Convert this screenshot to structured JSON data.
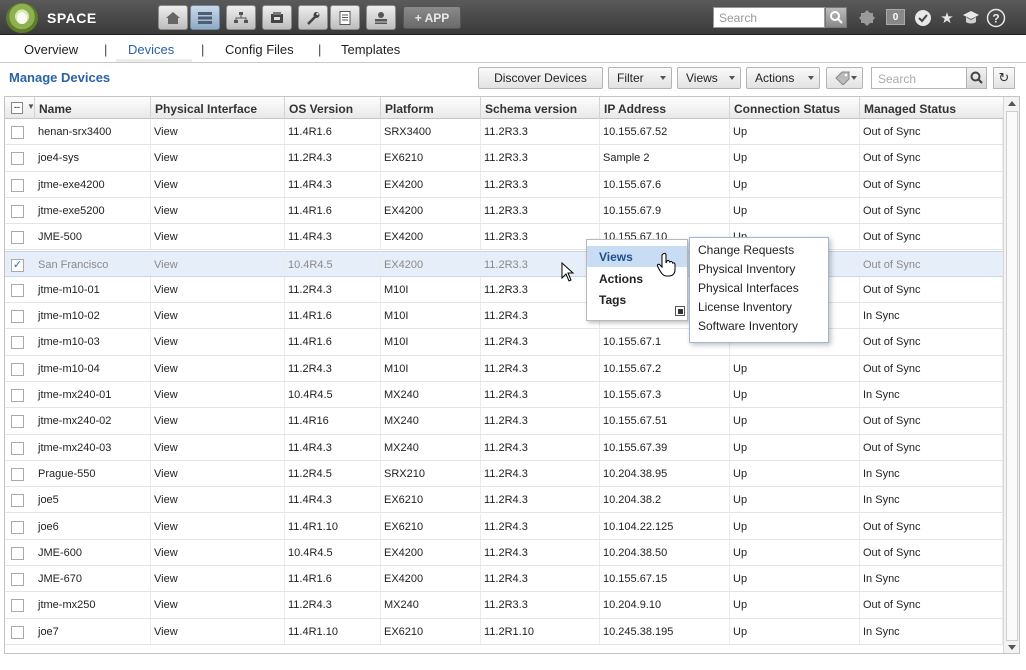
{
  "app": {
    "name": "SPACE",
    "add_app_label": "+ APP",
    "search_placeholder": "Search",
    "notification_count": "0"
  },
  "top_icons": [
    "home-icon",
    "devices-icon",
    "network-icon",
    "platform-icon",
    "tools-icon",
    "reports-icon",
    "admin-icon"
  ],
  "tabs": [
    {
      "label": "Overview",
      "active": false
    },
    {
      "label": "Devices",
      "active": true
    },
    {
      "label": "Config Files",
      "active": false
    },
    {
      "label": "Templates",
      "active": false
    }
  ],
  "tab_separator": "|",
  "toolbar": {
    "title": "Manage Devices",
    "discover_label": "Discover Devices",
    "filter_label": "Filter",
    "views_label": "Views",
    "actions_label": "Actions",
    "search_placeholder": "Search"
  },
  "columns": [
    "Name",
    "Physical Interface",
    "OS Version",
    "Platform",
    "Schema version",
    "IP Address",
    "Connection Status",
    "Managed Status"
  ],
  "header_check": "--",
  "rows": [
    {
      "name": "henan-srx3400",
      "phys": "View",
      "os": "11.4R1.6",
      "platform": "SRX3400",
      "schema": "11.2R3.3",
      "ip": "10.155.67.52",
      "conn": "Up",
      "managed": "Out of Sync",
      "checked": false
    },
    {
      "name": "joe4-sys",
      "phys": "View",
      "os": "11.2R4.3",
      "platform": "EX6210",
      "schema": "11.2R3.3",
      "ip": "Sample 2",
      "conn": "Up",
      "managed": "Out of Sync",
      "checked": false
    },
    {
      "name": "jtme-exe4200",
      "phys": "View",
      "os": "11.4R4.3",
      "platform": "EX4200",
      "schema": "11.2R3.3",
      "ip": "10.155.67.6",
      "conn": "Up",
      "managed": "Out of Sync",
      "checked": false
    },
    {
      "name": "jtme-exe5200",
      "phys": "View",
      "os": "11.4R1.6",
      "platform": "EX4200",
      "schema": "11.2R3.3",
      "ip": "10.155.67.9",
      "conn": "Up",
      "managed": "Out of Sync",
      "checked": false
    },
    {
      "name": "JME-500",
      "phys": "View",
      "os": "11.4R4.3",
      "platform": "EX4200",
      "schema": "11.2R3.3",
      "ip": "10.155.67.10",
      "conn": "Up",
      "managed": "Out of Sync",
      "checked": false
    },
    {
      "name": "San Francisco",
      "phys": "View",
      "os": "10.4R4.5",
      "platform": "EX4200",
      "schema": "11.2R3.3",
      "ip": "",
      "conn": "",
      "managed": "Out of Sync",
      "checked": true
    },
    {
      "name": "jtme-m10-01",
      "phys": "View",
      "os": "11.2R4.3",
      "platform": "M10I",
      "schema": "11.2R3.3",
      "ip": "",
      "conn": "",
      "managed": "Out of Sync",
      "checked": false
    },
    {
      "name": "jtme-m10-02",
      "phys": "View",
      "os": "11.4R1.6",
      "platform": "M10I",
      "schema": "11.2R4.3",
      "ip": "",
      "conn": "",
      "managed": "In Sync",
      "checked": false
    },
    {
      "name": "jtme-m10-03",
      "phys": "View",
      "os": "11.4R1.6",
      "platform": "M10I",
      "schema": "11.2R4.3",
      "ip": "10.155.67.1",
      "conn": "",
      "managed": "Out of Sync",
      "checked": false
    },
    {
      "name": "jtme-m10-04",
      "phys": "View",
      "os": "11.2R4.3",
      "platform": "M10I",
      "schema": "11.2R4.3",
      "ip": "10.155.67.2",
      "conn": "Up",
      "managed": "Out of Sync",
      "checked": false
    },
    {
      "name": "jtme-mx240-01",
      "phys": "View",
      "os": "10.4R4.5",
      "platform": "MX240",
      "schema": "11.2R4.3",
      "ip": "10.155.67.3",
      "conn": "Up",
      "managed": "In Sync",
      "checked": false
    },
    {
      "name": "jtme-mx240-02",
      "phys": "View",
      "os": "11.4R16",
      "platform": "MX240",
      "schema": "11.2R4.3",
      "ip": "10.155.67.51",
      "conn": "Up",
      "managed": "Out of Sync",
      "checked": false
    },
    {
      "name": "jtme-mx240-03",
      "phys": "View",
      "os": "11.4R4.3",
      "platform": "MX240",
      "schema": "11.2R4.3",
      "ip": "10.155.67.39",
      "conn": "Up",
      "managed": "Out of Sync",
      "checked": false
    },
    {
      "name": "Prague-550",
      "phys": "View",
      "os": "11.2R4.5",
      "platform": "SRX210",
      "schema": "11.2R4.3",
      "ip": "10.204.38.95",
      "conn": "Up",
      "managed": "In Sync",
      "checked": false
    },
    {
      "name": "joe5",
      "phys": "View",
      "os": "11.4R4.3",
      "platform": "EX6210",
      "schema": "11.2R4.3",
      "ip": "10.204.38.2",
      "conn": "Up",
      "managed": "In Sync",
      "checked": false
    },
    {
      "name": "joe6",
      "phys": "View",
      "os": "11.4R1.10",
      "platform": "EX6210",
      "schema": "11.2R4.3",
      "ip": "10.104.22.125",
      "conn": "Up",
      "managed": "Out of Sync",
      "checked": false
    },
    {
      "name": "JME-600",
      "phys": "View",
      "os": "10.4R4.5",
      "platform": "EX4200",
      "schema": "11.2R4.3",
      "ip": "10.204.38.50",
      "conn": "Up",
      "managed": "Out of Sync",
      "checked": false
    },
    {
      "name": "JME-670",
      "phys": "View",
      "os": "11.4R1.6",
      "platform": "EX4200",
      "schema": "11.2R4.3",
      "ip": "10.155.67.15",
      "conn": "Up",
      "managed": "In Sync",
      "checked": false
    },
    {
      "name": "jtme-mx250",
      "phys": "View",
      "os": "11.2R4.3",
      "platform": "MX240",
      "schema": "11.2R3.3",
      "ip": "10.204.9.10",
      "conn": "Up",
      "managed": "Out of Sync",
      "checked": false
    },
    {
      "name": "joe7",
      "phys": "View",
      "os": "11.4R1.10",
      "platform": "EX6210",
      "schema": "11.2R1.10",
      "ip": "10.245.38.195",
      "conn": "Up",
      "managed": "In Sync",
      "checked": false
    }
  ],
  "context_menu": {
    "items": [
      "Views",
      "Actions",
      "Tags"
    ],
    "highlighted": "Views",
    "submenu": [
      "Change Requests",
      "Physical Inventory",
      "Physical Interfaces",
      "License Inventory",
      "Software Inventory"
    ]
  },
  "colors": {
    "accent": "#2a63a8",
    "topbar": "#4a4a4a",
    "selected_row": "#e6eef9",
    "menu_highlight": "#c8dcf3"
  }
}
